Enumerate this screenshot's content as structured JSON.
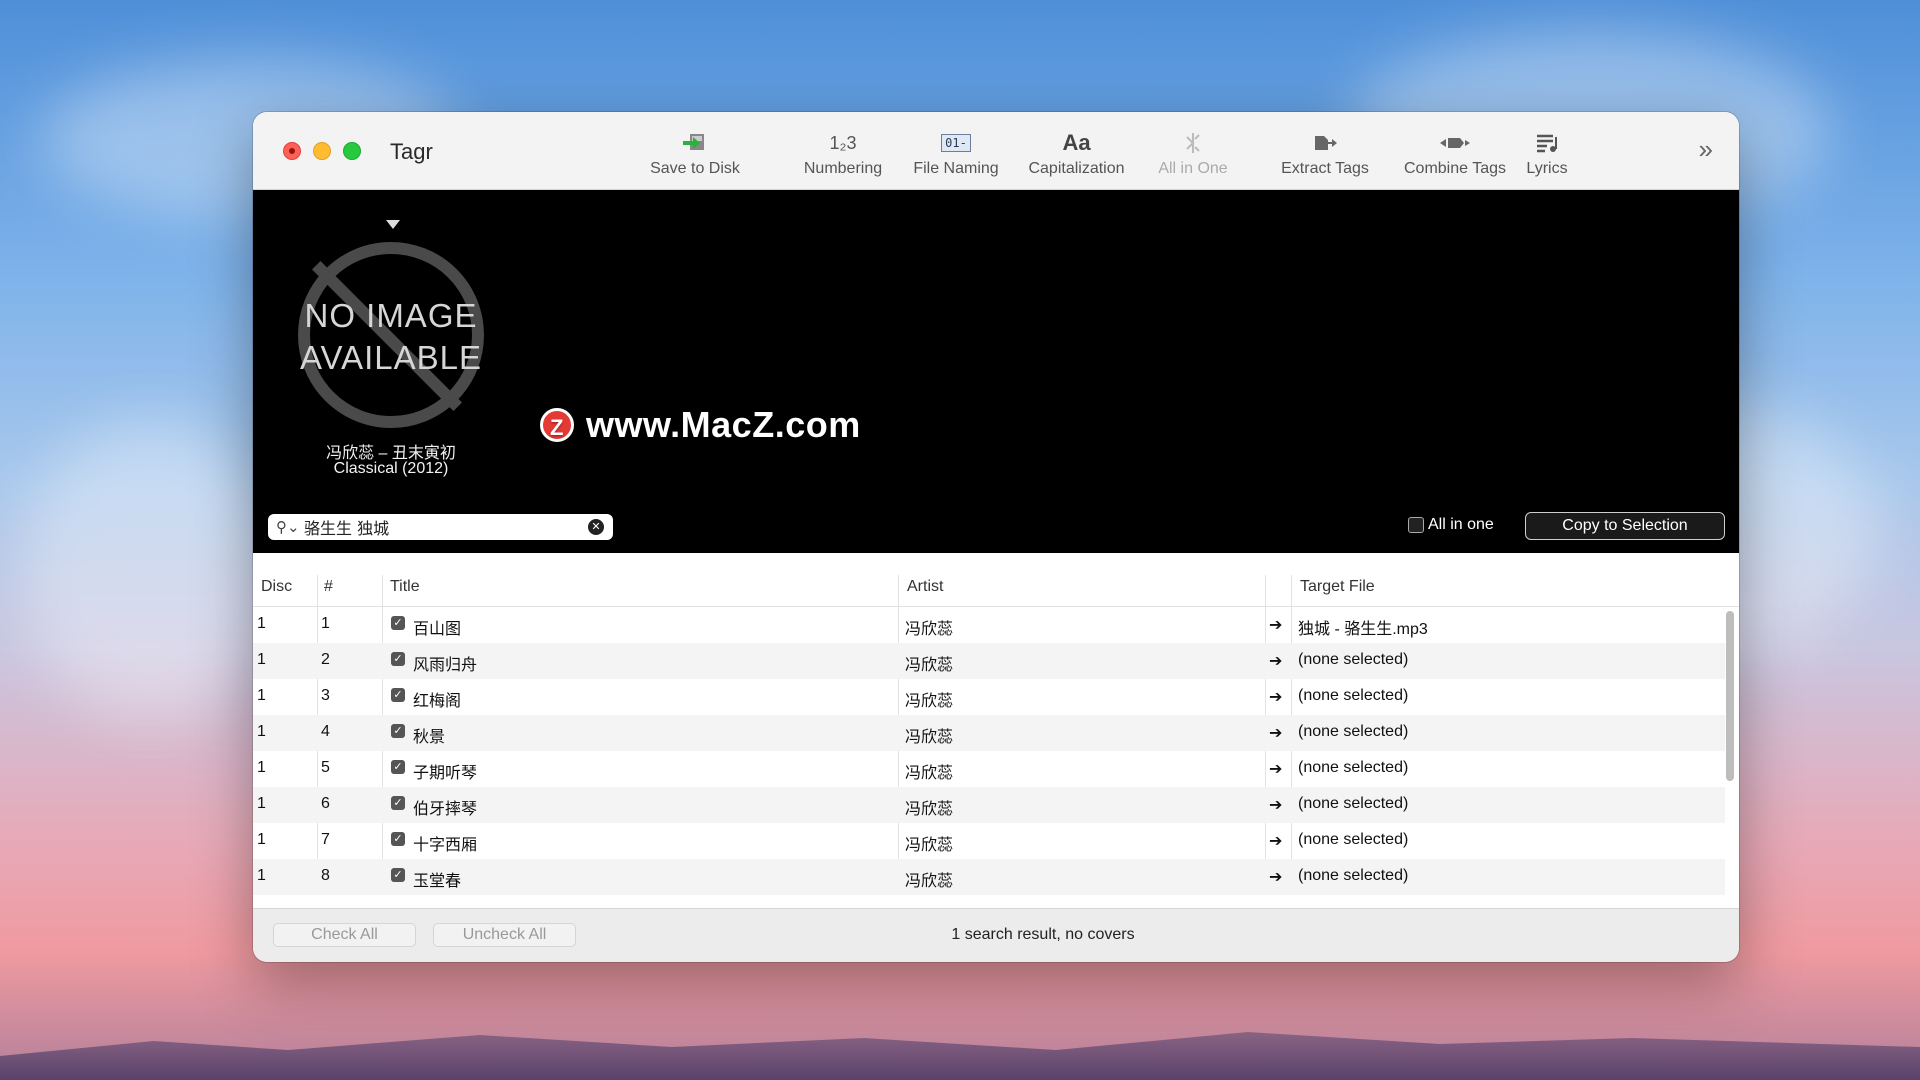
{
  "app": {
    "title": "Tagr"
  },
  "toolbar": {
    "items": [
      {
        "label": "Save to Disk",
        "icon": "save-disk-icon",
        "enabled": true
      },
      {
        "label": "Numbering",
        "icon": "numbering-icon",
        "glyph": "1₂3",
        "enabled": true
      },
      {
        "label": "File Naming",
        "icon": "file-naming-icon",
        "glyph": "01-",
        "enabled": true
      },
      {
        "label": "Capitalization",
        "icon": "capitalization-icon",
        "glyph": "Aa",
        "enabled": true
      },
      {
        "label": "All in One",
        "icon": "all-in-one-icon",
        "enabled": false
      },
      {
        "label": "Extract Tags",
        "icon": "extract-tags-icon",
        "enabled": true
      },
      {
        "label": "Combine Tags",
        "icon": "combine-tags-icon",
        "enabled": true
      },
      {
        "label": "Lyrics",
        "icon": "lyrics-icon",
        "enabled": true
      }
    ],
    "more_glyph": "»"
  },
  "cover": {
    "placeholder_line1": "NO IMAGE",
    "placeholder_line2": "AVAILABLE",
    "album_line1": "冯欣蕊 – 丑末寅初",
    "album_line2": "Classical (2012)"
  },
  "search": {
    "value": "骆生生 独城",
    "clear_glyph": "✕"
  },
  "options": {
    "all_in_one_label": "All in one",
    "all_in_one_checked": false,
    "copy_button": "Copy to Selection"
  },
  "watermark": {
    "logo": "Z",
    "text": "www.MacZ.com"
  },
  "table": {
    "headers": {
      "disc": "Disc",
      "num": "#",
      "title": "Title",
      "artist": "Artist",
      "target": "Target File"
    },
    "rows": [
      {
        "disc": "1",
        "num": "1",
        "title": "百山图",
        "artist": "冯欣蕊",
        "target": "独城 - 骆生生.mp3"
      },
      {
        "disc": "1",
        "num": "2",
        "title": "风雨归舟",
        "artist": "冯欣蕊",
        "target": "(none selected)"
      },
      {
        "disc": "1",
        "num": "3",
        "title": "红梅阁",
        "artist": "冯欣蕊",
        "target": "(none selected)"
      },
      {
        "disc": "1",
        "num": "4",
        "title": "秋景",
        "artist": "冯欣蕊",
        "target": "(none selected)"
      },
      {
        "disc": "1",
        "num": "5",
        "title": "子期听琴",
        "artist": "冯欣蕊",
        "target": "(none selected)"
      },
      {
        "disc": "1",
        "num": "6",
        "title": "伯牙摔琴",
        "artist": "冯欣蕊",
        "target": "(none selected)"
      },
      {
        "disc": "1",
        "num": "7",
        "title": "十字西厢",
        "artist": "冯欣蕊",
        "target": "(none selected)"
      },
      {
        "disc": "1",
        "num": "8",
        "title": "玉堂春",
        "artist": "冯欣蕊",
        "target": "(none selected)"
      }
    ],
    "arrow_glyph": "➔",
    "check_glyph": "✓"
  },
  "footer": {
    "check_all": "Check All",
    "uncheck_all": "Uncheck All",
    "status": "1 search result, no covers"
  }
}
